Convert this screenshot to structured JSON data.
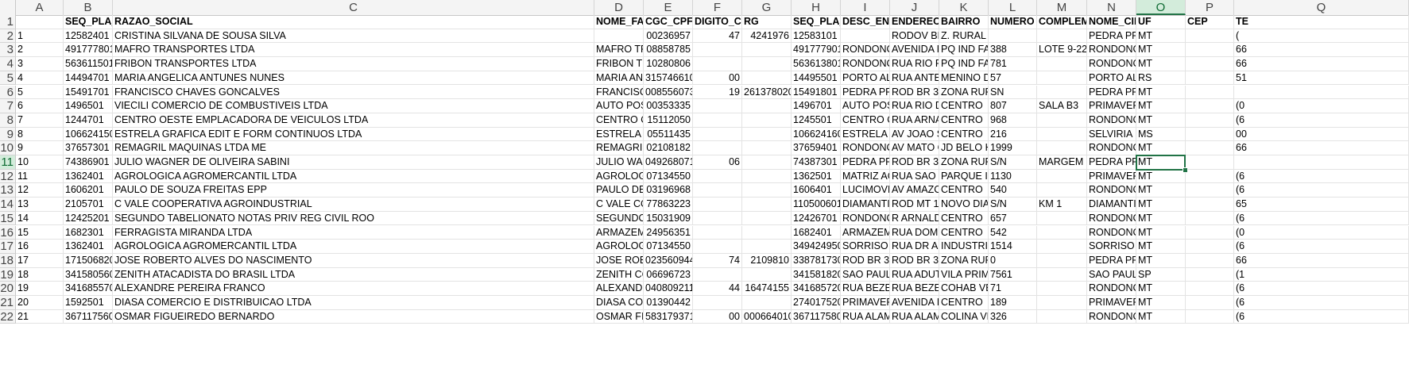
{
  "columns": [
    "A",
    "B",
    "C",
    "D",
    "E",
    "F",
    "G",
    "H",
    "I",
    "J",
    "K",
    "L",
    "M",
    "N",
    "O",
    "P",
    "Q"
  ],
  "active_column": "O",
  "active_row": 11,
  "headers": {
    "B": "SEQ_PLA_C",
    "C": "RAZAO_SOCIAL",
    "D": "NOME_FAN",
    "E": "CGC_CPF",
    "F": "DIGITO_CP",
    "G": "RG",
    "H": "SEQ_PLA_E",
    "I": "DESC_END",
    "J": "ENDERECO",
    "K": "BAIRRO",
    "L": "NUMERO",
    "M": "COMPLEMI",
    "N": "NOME_CID",
    "O": "UF",
    "P": "CEP",
    "Q": "TE"
  },
  "rows": [
    {
      "A": "1",
      "B": "12582401",
      "C": "CRISTINA SILVANA DE SOUSA SILVA",
      "D": "",
      "E": "00236957",
      "F": "47",
      "G": "4241976",
      "H": "12583101",
      "I": "",
      "J": "RODOV BR",
      "K": "Z. RURAL",
      "L": "",
      "M": "",
      "N": "PEDRA PRE",
      "O": "MT",
      "P": "",
      "Q": "("
    },
    {
      "A": "2",
      "B": "491777801",
      "C": "MAFRO TRANSPORTES LTDA",
      "D": "MAFRO TR",
      "E": "08858785",
      "F": "",
      "G": "",
      "H": "491777901",
      "I": "RONDONC",
      "J": "AVENIDA F",
      "K": "PQ IND FA",
      "L": "388",
      "M": "LOTE 9-22",
      "N": "RONDONC",
      "O": "MT",
      "P": "",
      "Q": "66"
    },
    {
      "A": "3",
      "B": "563611501",
      "C": "FRIBON TRANSPORTES LTDA",
      "D": "FRIBON TF",
      "E": "10280806",
      "F": "",
      "G": "",
      "H": "563613801",
      "I": "RONDONC",
      "J": "RUA RIO P",
      "K": "PQ IND FA",
      "L": "781",
      "M": "",
      "N": "RONDONC",
      "O": "MT",
      "P": "",
      "Q": "66"
    },
    {
      "A": "4",
      "B": "14494701",
      "C": "MARIA ANGELICA ANTUNES NUNES",
      "D": "MARIA AN",
      "E": "315746610",
      "F": "00",
      "G": "",
      "H": "14495501",
      "I": "PORTO ALE",
      "J": "RUA ANTE",
      "K": "MENINO D",
      "L": "57",
      "M": "",
      "N": "PORTO ALE",
      "O": "RS",
      "P": "",
      "Q": "51"
    },
    {
      "A": "5",
      "B": "15491701",
      "C": "FRANCISCO CHAVES GONCALVES",
      "D": "FRANCISC",
      "E": "008556073",
      "F": "19",
      "G": "261378020",
      "H": "15491801",
      "I": "PEDRA PRE",
      "J": "ROD BR 36",
      "K": "ZONA RUR",
      "L": "SN",
      "M": "",
      "N": "PEDRA PRE",
      "O": "MT",
      "P": "",
      "Q": ""
    },
    {
      "A": "6",
      "B": "1496501",
      "C": "VIECILI COMERCIO DE COMBUSTIVEIS LTDA",
      "D": "AUTO POST",
      "E": "00353335",
      "F": "",
      "G": "",
      "H": "1496701",
      "I": "AUTO POST",
      "J": "RUA RIO D",
      "K": "CENTRO",
      "L": "807",
      "M": "SALA B3",
      "N": "PRIMAVER",
      "O": "MT",
      "P": "",
      "Q": "(0"
    },
    {
      "A": "7",
      "B": "1244701",
      "C": "CENTRO OESTE EMPLACADORA DE VEICULOS LTDA",
      "D": "CENTRO O",
      "E": "15112050",
      "F": "",
      "G": "",
      "H": "1245501",
      "I": "CENTRO O",
      "J": "RUA ARNA",
      "K": "CENTRO",
      "L": "968",
      "M": "",
      "N": "RONDONC",
      "O": "MT",
      "P": "",
      "Q": "(6"
    },
    {
      "A": "8",
      "B": "106624150",
      "C": "ESTRELA GRAFICA EDIT E FORM CONTINUOS LTDA",
      "D": "ESTRELA G",
      "E": "05511435",
      "F": "",
      "G": "",
      "H": "106624160",
      "I": "ESTRELA G",
      "J": "AV JOAO S",
      "K": "CENTRO",
      "L": "216",
      "M": "",
      "N": "SELVIRIA",
      "O": "MS",
      "P": "",
      "Q": "00"
    },
    {
      "A": "9",
      "B": "37657301",
      "C": "REMAGRIL MAQUINAS LTDA ME",
      "D": "REMAGRIL",
      "E": "02108182",
      "F": "",
      "G": "",
      "H": "37659401",
      "I": "RONDONC",
      "J": "AV MATO C",
      "K": "JD BELO H",
      "L": "1999",
      "M": "",
      "N": "RONDONC",
      "O": "MT",
      "P": "",
      "Q": "66"
    },
    {
      "A": "10",
      "B": "74386901",
      "C": "JULIO WAGNER DE OLIVEIRA SABINI",
      "D": "JULIO WAC",
      "E": "049268071",
      "F": "06",
      "G": "",
      "H": "74387301",
      "I": "PEDRA PRE",
      "J": "ROD BR 36",
      "K": "ZONA RUR",
      "L": "S/N",
      "M": "MARGEM E",
      "N": "PEDRA PRE",
      "O": "MT",
      "P": "",
      "Q": ""
    },
    {
      "A": "11",
      "B": "1362401",
      "C": "AGROLOGICA AGROMERCANTIL LTDA",
      "D": "AGROLOGI",
      "E": "07134550",
      "F": "",
      "G": "",
      "H": "1362501",
      "I": "MATRIZ AC",
      "J": "RUA SAO F",
      "K": "PARQUE IN",
      "L": "1130",
      "M": "",
      "N": "PRIMAVER",
      "O": "MT",
      "P": "",
      "Q": "(6"
    },
    {
      "A": "12",
      "B": "1606201",
      "C": "PAULO DE SOUZA FREITAS EPP",
      "D": "PAULO DE",
      "E": "03196968",
      "F": "",
      "G": "",
      "H": "1606401",
      "I": "LUCIMOVE",
      "J": "AV AMAZC",
      "K": "CENTRO",
      "L": "540",
      "M": "",
      "N": "RONDONC",
      "O": "MT",
      "P": "",
      "Q": "(6"
    },
    {
      "A": "13",
      "B": "2105701",
      "C": "C VALE  COOPERATIVA AGROINDUSTRIAL",
      "D": "C VALE  CO",
      "E": "77863223",
      "F": "",
      "G": "",
      "H": "110500601",
      "I": "DIAMANTI",
      "J": "ROD MT 12",
      "K": "NOVO DIA",
      "L": "S/N",
      "M": "KM 1",
      "N": "DIAMANTI",
      "O": "MT",
      "P": "",
      "Q": "65"
    },
    {
      "A": "14",
      "B": "12425201",
      "C": "SEGUNDO TABELIONATO NOTAS PRIV REG CIVIL ROO",
      "D": "SEGUNDO",
      "E": "15031909",
      "F": "",
      "G": "",
      "H": "12426701",
      "I": "RONDONC",
      "J": "R ARNALD",
      "K": "CENTRO",
      "L": "657",
      "M": "",
      "N": "RONDONC",
      "O": "MT",
      "P": "",
      "Q": "(6"
    },
    {
      "A": "15",
      "B": "1682301",
      "C": "FERRAGISTA MIRANDA LTDA",
      "D": "ARMAZEM",
      "E": "24956351",
      "F": "",
      "G": "",
      "H": "1682401",
      "I": "ARMAZEM",
      "J": "RUA DOM",
      "K": "CENTRO",
      "L": "542",
      "M": "",
      "N": "RONDONC",
      "O": "MT",
      "P": "",
      "Q": "(0"
    },
    {
      "A": "16",
      "B": "1362401",
      "C": "AGROLOGICA AGROMERCANTIL LTDA",
      "D": "AGROLOGI",
      "E": "07134550",
      "F": "",
      "G": "",
      "H": "349424950",
      "I": "SORRISO",
      "J": "RUA DR AF",
      "K": "INDUSTRI",
      "L": "1514",
      "M": "",
      "N": "SORRISO",
      "O": "MT",
      "P": "",
      "Q": "(6"
    },
    {
      "A": "17",
      "B": "171506820",
      "C": "JOSE ROBERTO ALVES DO NASCIMENTO",
      "D": "JOSE ROBE",
      "E": "023560944",
      "F": "74",
      "G": "2109810",
      "H": "338781730",
      "I": "ROD BR 36",
      "J": "ROD BR 36",
      "K": "ZONA RUR",
      "L": "0",
      "M": "",
      "N": "PEDRA PRE",
      "O": "MT",
      "P": "",
      "Q": "66"
    },
    {
      "A": "18",
      "B": "341580560",
      "C": "ZENITH ATACADISTA DO BRASIL LTDA",
      "D": "ZENITH CC",
      "E": "06696723",
      "F": "",
      "G": "",
      "H": "341581820",
      "I": "SAO PAULC",
      "J": "RUA ADUT",
      "K": "VILA PRIM",
      "L": "7561",
      "M": "",
      "N": "SAO PAULC",
      "O": "SP",
      "P": "",
      "Q": "(1"
    },
    {
      "A": "19",
      "B": "341685570",
      "C": "ALEXANDRE PEREIRA FRANCO",
      "D": "ALEXANDR",
      "E": "040809211",
      "F": "44",
      "G": "16474155",
      "H": "341685720",
      "I": "RUA BEZEF",
      "J": "RUA BEZEF",
      "K": "COHAB VE",
      "L": "71",
      "M": "",
      "N": "RONDONC",
      "O": "MT",
      "P": "",
      "Q": "(6"
    },
    {
      "A": "20",
      "B": "1592501",
      "C": "DIASA COMERCIO E DISTRIBUICAO LTDA",
      "D": "DIASA COM",
      "E": "01390442",
      "F": "",
      "G": "",
      "H": "274017520",
      "I": "PRIMAVER",
      "J": "AVENIDA I",
      "K": "CENTRO",
      "L": "189",
      "M": "",
      "N": "PRIMAVER",
      "O": "MT",
      "P": "",
      "Q": "(6"
    },
    {
      "A": "21",
      "B": "367117560",
      "C": "OSMAR FIGUEIREDO BERNARDO",
      "D": "OSMAR FI",
      "E": "583179371",
      "F": "00",
      "G": "000664010",
      "H": "367117580",
      "I": "RUA ALAM",
      "J": "RUA ALAM",
      "K": "COLINA VE",
      "L": "326",
      "M": "",
      "N": "RONDONC",
      "O": "MT",
      "P": "",
      "Q": "(6"
    }
  ]
}
